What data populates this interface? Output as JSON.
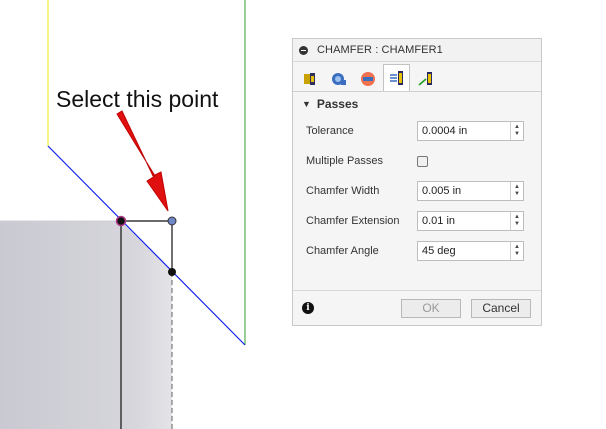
{
  "annotation": {
    "text": "Select this point"
  },
  "dialog": {
    "title": "CHAMFER : CHAMFER1",
    "tabs": [
      {
        "icon": "tool-icon",
        "active": false
      },
      {
        "icon": "geometry-icon",
        "active": false
      },
      {
        "icon": "heights-icon",
        "active": false
      },
      {
        "icon": "passes-icon",
        "active": true
      },
      {
        "icon": "linking-icon",
        "active": false
      }
    ],
    "section_title": "Passes",
    "fields": {
      "tolerance": {
        "label": "Tolerance",
        "value": "0.0004 in"
      },
      "multiple_passes": {
        "label": "Multiple Passes",
        "checked": false
      },
      "chamfer_width": {
        "label": "Chamfer Width",
        "value": "0.005 in"
      },
      "chamfer_extension": {
        "label": "Chamfer Extension",
        "value": "0.01 in"
      },
      "chamfer_angle": {
        "label": "Chamfer Angle",
        "value": "45 deg"
      }
    },
    "buttons": {
      "ok": "OK",
      "cancel": "Cancel"
    }
  },
  "colors": {
    "arrow": "#e01010",
    "blue_line": "#1020ee",
    "yellow_line": "#f0f000",
    "green_line": "#2ca02c",
    "point_selected": "#6f86c8"
  }
}
